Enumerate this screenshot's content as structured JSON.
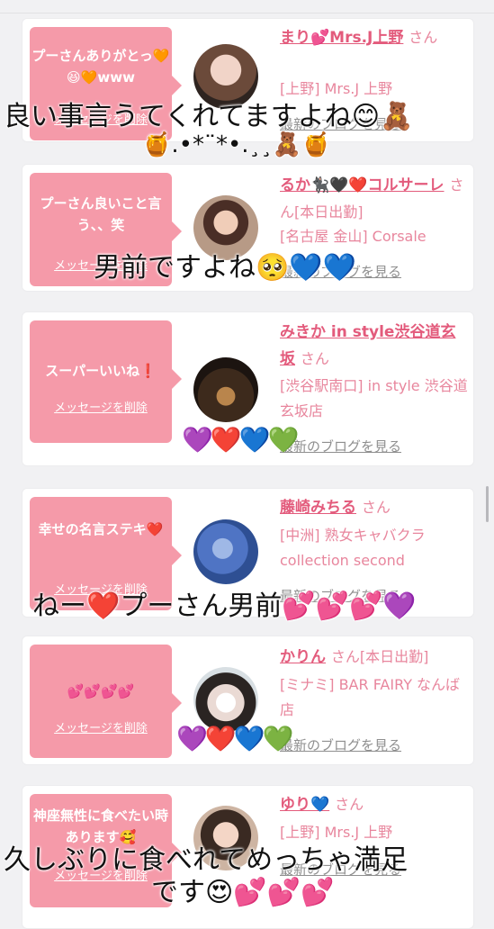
{
  "items": [
    {
      "message": "プーさんありがとっ🧡😆🧡www",
      "delete_label": "メッセージを削除",
      "name": "まり💕Mrs.J上野",
      "san": "さん",
      "shop": "[上野] Mrs.J 上野",
      "blog_label": "最新のブログを見る"
    },
    {
      "message": "プーさん良いこと言う、、笑",
      "delete_label": "メッセージを削除",
      "name": "るか🐈‍⬛🖤❤️コルサーレ",
      "san": "さん[本日出勤]",
      "shop": "[名古屋 金山] Corsale",
      "blog_label": "最新のブログを見る"
    },
    {
      "message": "スーパーいいね❗️",
      "delete_label": "メッセージを削除",
      "name": "みきか in style渋谷道玄坂",
      "san": "さん",
      "shop": "[渋谷駅南口] in style 渋谷道玄坂店",
      "blog_label": "最新のブログを見る"
    },
    {
      "message": "幸せの名言ステキ❤️",
      "delete_label": "メッセージを削除",
      "name": "藤崎みちる",
      "san": "さん",
      "shop": "[中洲] 熟女キャバクラ collection second",
      "blog_label": "最新のブログを見る"
    },
    {
      "message": "💕💕💕💕",
      "delete_label": "メッセージを削除",
      "name": "かりん",
      "san": "さん[本日出勤]",
      "shop": "[ミナミ] BAR FAIRY なんば店",
      "blog_label": "最新のブログを見る"
    },
    {
      "message": "神座無性に食べたい時あります🥰",
      "delete_label": "メッセージを削除",
      "name": "ゆり💙",
      "san": "さん",
      "shop": "[上野] Mrs.J 上野",
      "blog_label": "最新のブログを見る"
    }
  ],
  "overlays": {
    "line1": "良い事言うてくれてますよね😊🧸",
    "line1b": "🍯.•*¨*•.¸¸🧸🍯",
    "line2": "男前ですよね🥺💙💙",
    "hearts3": "💜❤️💙💚",
    "line4": "ねー❤️プーさん男前💕💕💕💜",
    "hearts5": "💜❤️💙💚",
    "line6a": "久しぶりに食べれてめっちゃ満足",
    "line6b": "です😍💕💕💕"
  }
}
